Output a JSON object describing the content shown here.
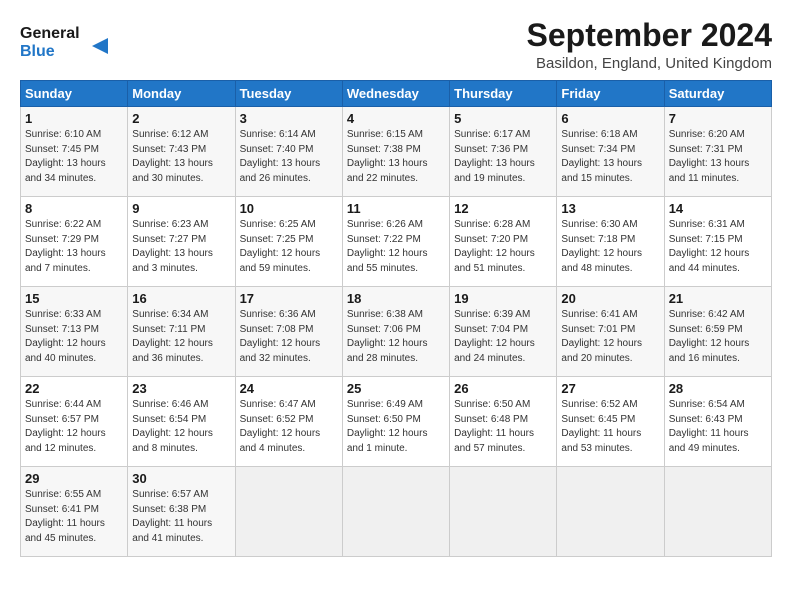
{
  "header": {
    "logo_line1": "General",
    "logo_line2": "Blue",
    "month_title": "September 2024",
    "location": "Basildon, England, United Kingdom"
  },
  "days_of_week": [
    "Sunday",
    "Monday",
    "Tuesday",
    "Wednesday",
    "Thursday",
    "Friday",
    "Saturday"
  ],
  "weeks": [
    [
      {
        "day": "1",
        "rise": "6:10 AM",
        "set": "7:45 PM",
        "daylight": "13 hours and 34 minutes."
      },
      {
        "day": "2",
        "rise": "6:12 AM",
        "set": "7:43 PM",
        "daylight": "13 hours and 30 minutes."
      },
      {
        "day": "3",
        "rise": "6:14 AM",
        "set": "7:40 PM",
        "daylight": "13 hours and 26 minutes."
      },
      {
        "day": "4",
        "rise": "6:15 AM",
        "set": "7:38 PM",
        "daylight": "13 hours and 22 minutes."
      },
      {
        "day": "5",
        "rise": "6:17 AM",
        "set": "7:36 PM",
        "daylight": "13 hours and 19 minutes."
      },
      {
        "day": "6",
        "rise": "6:18 AM",
        "set": "7:34 PM",
        "daylight": "13 hours and 15 minutes."
      },
      {
        "day": "7",
        "rise": "6:20 AM",
        "set": "7:31 PM",
        "daylight": "13 hours and 11 minutes."
      }
    ],
    [
      {
        "day": "8",
        "rise": "6:22 AM",
        "set": "7:29 PM",
        "daylight": "13 hours and 7 minutes."
      },
      {
        "day": "9",
        "rise": "6:23 AM",
        "set": "7:27 PM",
        "daylight": "13 hours and 3 minutes."
      },
      {
        "day": "10",
        "rise": "6:25 AM",
        "set": "7:25 PM",
        "daylight": "12 hours and 59 minutes."
      },
      {
        "day": "11",
        "rise": "6:26 AM",
        "set": "7:22 PM",
        "daylight": "12 hours and 55 minutes."
      },
      {
        "day": "12",
        "rise": "6:28 AM",
        "set": "7:20 PM",
        "daylight": "12 hours and 51 minutes."
      },
      {
        "day": "13",
        "rise": "6:30 AM",
        "set": "7:18 PM",
        "daylight": "12 hours and 48 minutes."
      },
      {
        "day": "14",
        "rise": "6:31 AM",
        "set": "7:15 PM",
        "daylight": "12 hours and 44 minutes."
      }
    ],
    [
      {
        "day": "15",
        "rise": "6:33 AM",
        "set": "7:13 PM",
        "daylight": "12 hours and 40 minutes."
      },
      {
        "day": "16",
        "rise": "6:34 AM",
        "set": "7:11 PM",
        "daylight": "12 hours and 36 minutes."
      },
      {
        "day": "17",
        "rise": "6:36 AM",
        "set": "7:08 PM",
        "daylight": "12 hours and 32 minutes."
      },
      {
        "day": "18",
        "rise": "6:38 AM",
        "set": "7:06 PM",
        "daylight": "12 hours and 28 minutes."
      },
      {
        "day": "19",
        "rise": "6:39 AM",
        "set": "7:04 PM",
        "daylight": "12 hours and 24 minutes."
      },
      {
        "day": "20",
        "rise": "6:41 AM",
        "set": "7:01 PM",
        "daylight": "12 hours and 20 minutes."
      },
      {
        "day": "21",
        "rise": "6:42 AM",
        "set": "6:59 PM",
        "daylight": "12 hours and 16 minutes."
      }
    ],
    [
      {
        "day": "22",
        "rise": "6:44 AM",
        "set": "6:57 PM",
        "daylight": "12 hours and 12 minutes."
      },
      {
        "day": "23",
        "rise": "6:46 AM",
        "set": "6:54 PM",
        "daylight": "12 hours and 8 minutes."
      },
      {
        "day": "24",
        "rise": "6:47 AM",
        "set": "6:52 PM",
        "daylight": "12 hours and 4 minutes."
      },
      {
        "day": "25",
        "rise": "6:49 AM",
        "set": "6:50 PM",
        "daylight": "12 hours and 1 minute."
      },
      {
        "day": "26",
        "rise": "6:50 AM",
        "set": "6:48 PM",
        "daylight": "11 hours and 57 minutes."
      },
      {
        "day": "27",
        "rise": "6:52 AM",
        "set": "6:45 PM",
        "daylight": "11 hours and 53 minutes."
      },
      {
        "day": "28",
        "rise": "6:54 AM",
        "set": "6:43 PM",
        "daylight": "11 hours and 49 minutes."
      }
    ],
    [
      {
        "day": "29",
        "rise": "6:55 AM",
        "set": "6:41 PM",
        "daylight": "11 hours and 45 minutes."
      },
      {
        "day": "30",
        "rise": "6:57 AM",
        "set": "6:38 PM",
        "daylight": "11 hours and 41 minutes."
      },
      null,
      null,
      null,
      null,
      null
    ]
  ]
}
